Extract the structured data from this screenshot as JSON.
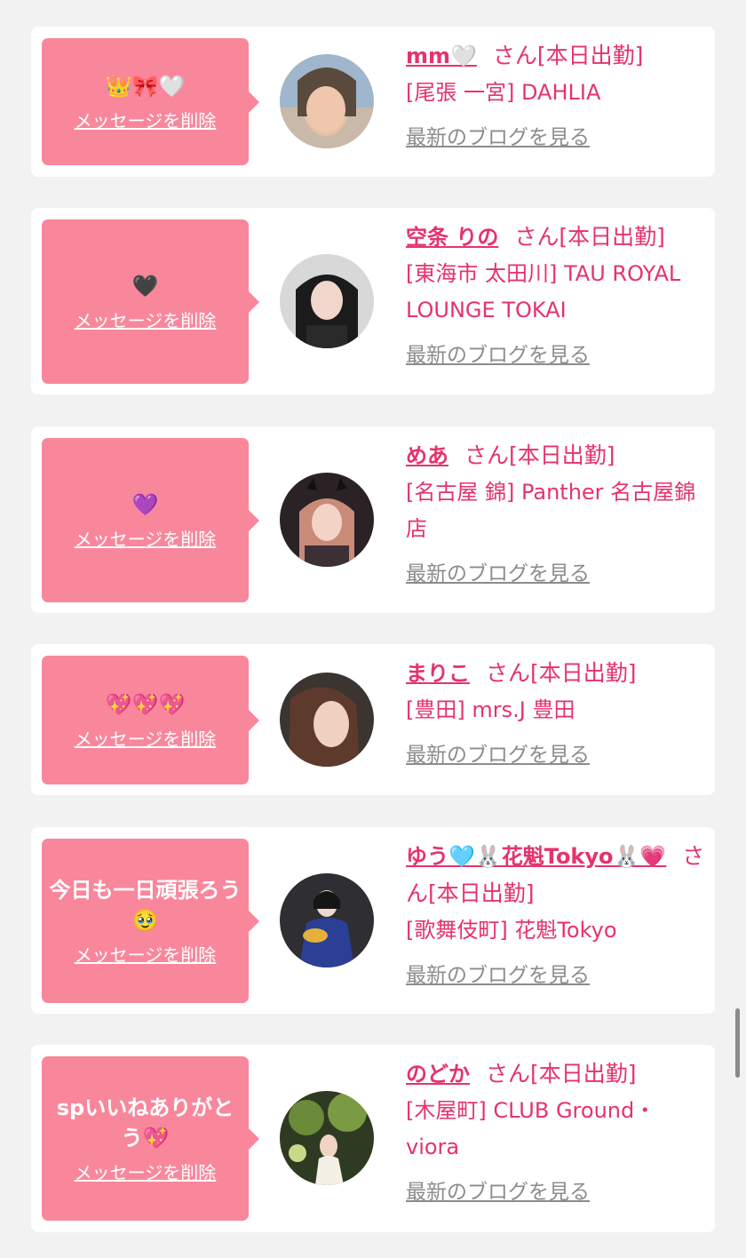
{
  "common": {
    "delete_label": "メッセージを削除",
    "blog_label": "最新のブログを見る",
    "san_label": "さん[本日出勤]"
  },
  "cards": [
    {
      "message": "👑🎀🤍",
      "name": "mm🤍",
      "location": "[尾張 一宮] DAHLIA"
    },
    {
      "message": "🖤",
      "name": "空条 りの",
      "location": "[東海市 太田川] TAU ROYAL LOUNGE TOKAI"
    },
    {
      "message": "💜",
      "name": "めあ",
      "location": "[名古屋 錦] Panther 名古屋錦店"
    },
    {
      "message": "💖💖💖",
      "name": "まりこ",
      "location": "[豊田] mrs.J 豊田"
    },
    {
      "message": "今日も一日頑張ろう🥹",
      "name": "ゆう🩵🐰花魁Tokyo🐰💗",
      "location": "[歌舞伎町] 花魁Tokyo"
    },
    {
      "message": "spいいねありがとう💖",
      "name": "のどか",
      "location": "[木屋町] CLUB Ground・viora"
    }
  ],
  "colors": {
    "accent": "#e5336c",
    "bubble": "#f9879c",
    "background": "#f2f2f2"
  }
}
